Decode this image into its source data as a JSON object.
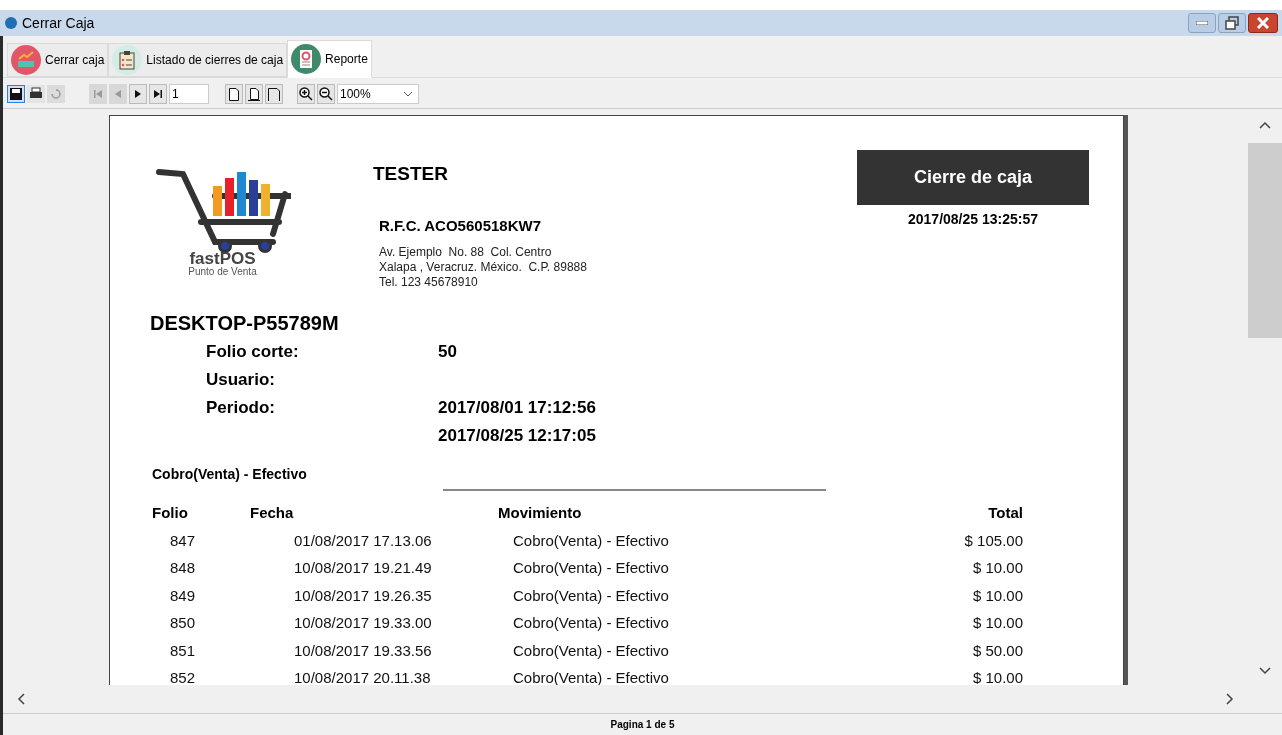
{
  "window": {
    "title": "Cerrar Caja"
  },
  "tabs": [
    {
      "label": "Cerrar caja",
      "selected": false,
      "kind": "cash"
    },
    {
      "label": "Listado de cierres de caja",
      "selected": false,
      "kind": "list"
    },
    {
      "label": "Reporte",
      "selected": true,
      "kind": "report"
    }
  ],
  "toolbar": {
    "page": "1",
    "zoom": "100%"
  },
  "report": {
    "company": "TESTER",
    "logo_name": "fastPOS",
    "logo_tagline": "Punto de Venta",
    "rfc": "R.F.C. ACO560518KW7",
    "address": [
      "Av. Ejemplo  No. 88  Col. Centro",
      "Xalapa , Veracruz. México.  C.P. 89888",
      "Tel. 123 45678910"
    ],
    "title": "Cierre de caja",
    "date": "2017/08/25 13:25:57",
    "machine": "DESKTOP-P55789M",
    "fields": [
      {
        "label": "Folio corte:",
        "value": "50"
      },
      {
        "label": "Usuario:"
      },
      {
        "label": "Periodo:",
        "value": "2017/08/01 17:12:56"
      },
      {
        "value": "2017/08/25 12:17:05"
      }
    ],
    "section": "Cobro(Venta) - Efectivo",
    "columns": [
      "Folio",
      "Fecha",
      "Movimiento",
      "Total"
    ],
    "rows": [
      [
        "847",
        "01/08/2017 17.13.06",
        "Cobro(Venta) - Efectivo",
        "$ 105.00"
      ],
      [
        "848",
        "10/08/2017 19.21.49",
        "Cobro(Venta) - Efectivo",
        "$ 10.00"
      ],
      [
        "849",
        "10/08/2017 19.26.35",
        "Cobro(Venta) - Efectivo",
        "$ 10.00"
      ],
      [
        "850",
        "10/08/2017 19.33.00",
        "Cobro(Venta) - Efectivo",
        "$ 10.00"
      ],
      [
        "851",
        "10/08/2017 19.33.56",
        "Cobro(Venta) - Efectivo",
        "$ 50.00"
      ],
      [
        "852",
        "10/08/2017 20.11.38",
        "Cobro(Venta) - Efectivo",
        "$ 10.00"
      ]
    ]
  },
  "status_bar": "Pagina 1 de 5"
}
